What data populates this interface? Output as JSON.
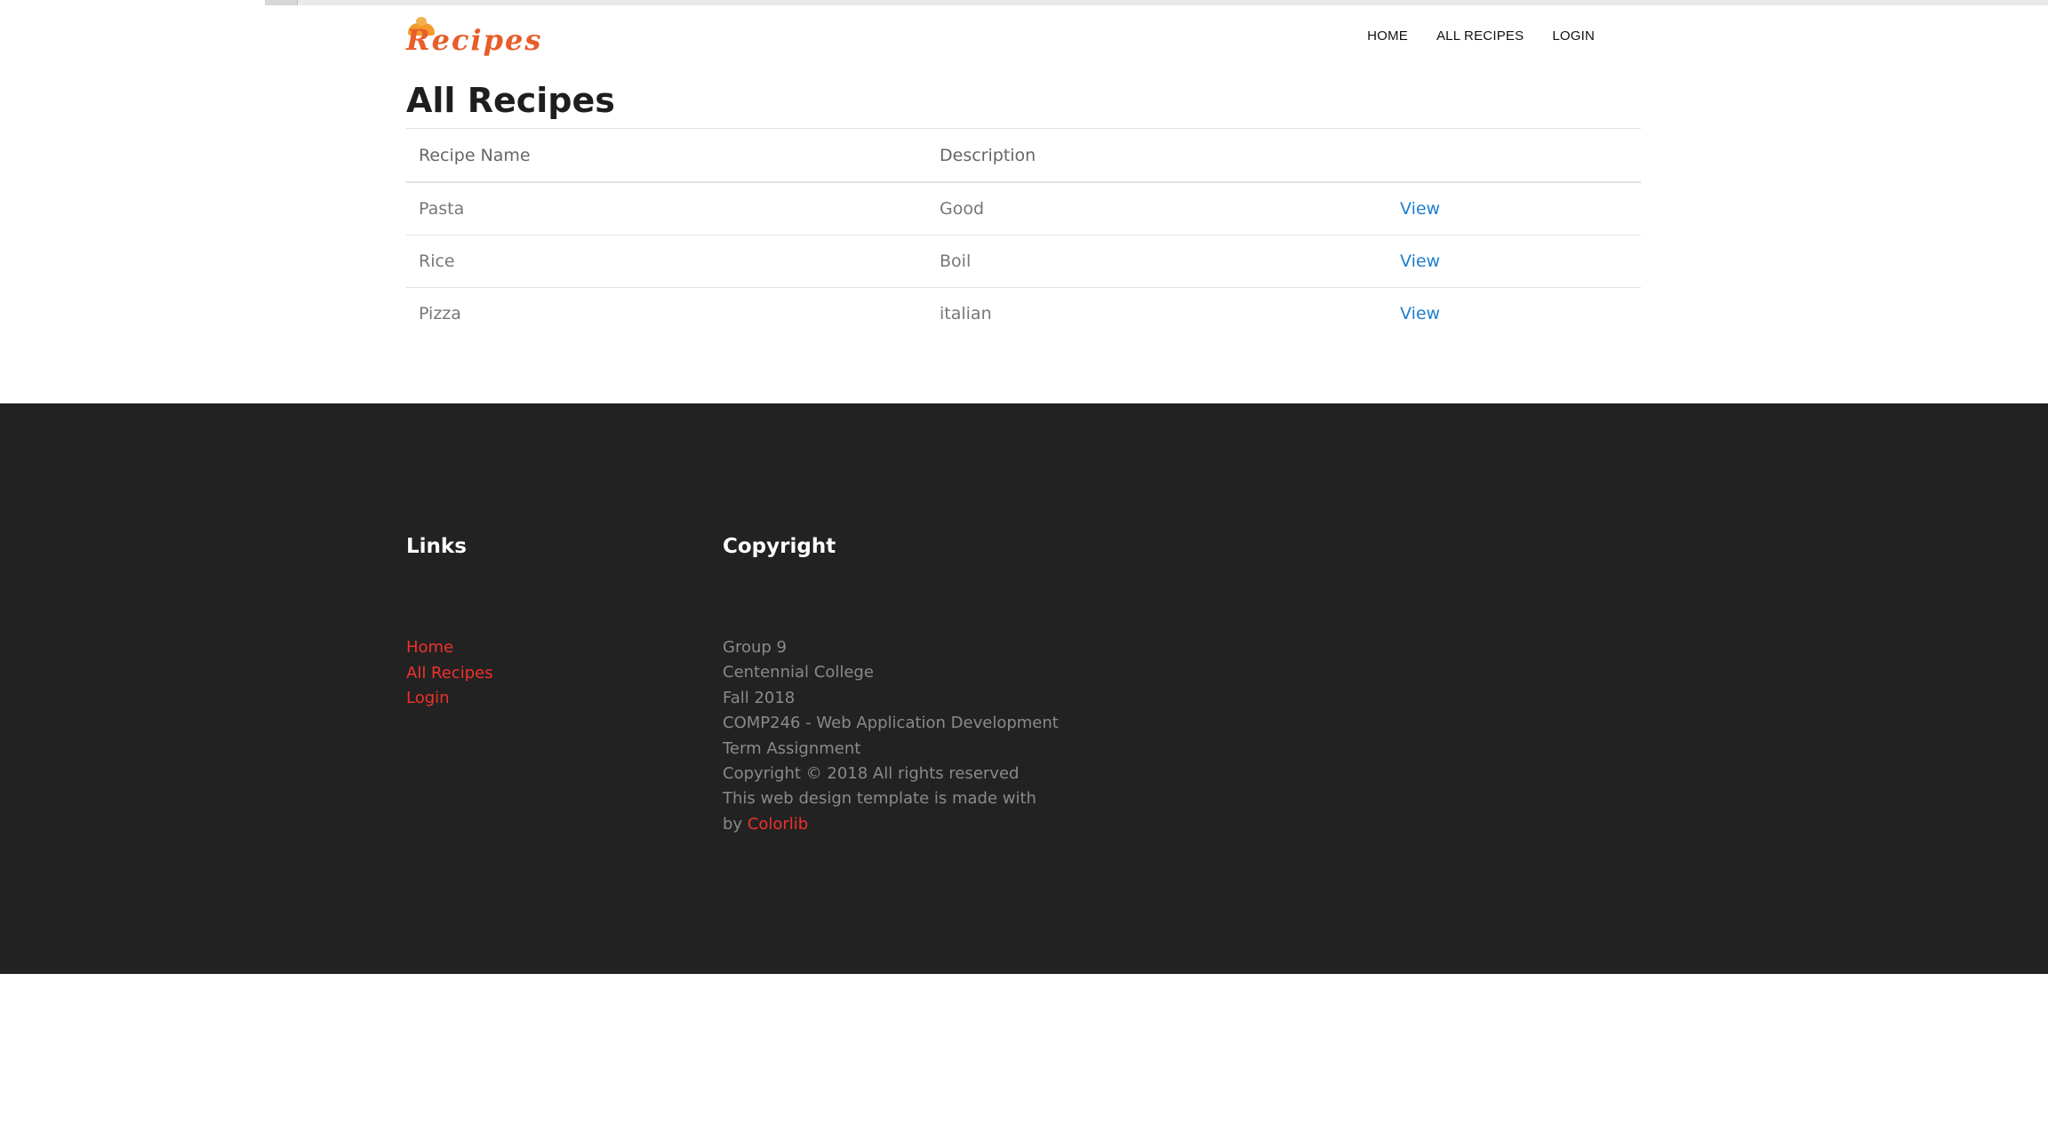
{
  "header": {
    "logo_text": "Recipes",
    "nav": [
      "HOME",
      "ALL RECIPES",
      "LOGIN"
    ]
  },
  "main": {
    "title": "All Recipes",
    "columns": [
      "Recipe Name",
      "Description",
      ""
    ],
    "rows": [
      {
        "name": "Pasta",
        "description": "Good",
        "action": "View"
      },
      {
        "name": "Rice",
        "description": "Boil",
        "action": "View"
      },
      {
        "name": "Pizza",
        "description": "italian",
        "action": "View"
      }
    ]
  },
  "footer": {
    "links_heading": "Links",
    "links": [
      "Home",
      "All Recipes",
      "Login"
    ],
    "copyright_heading": "Copyright",
    "copyright_lines": [
      "Group 9",
      "Centennial College",
      "Fall 2018",
      "COMP246 - Web Application Development",
      "Term Assignment",
      "Copyright © 2018 All rights reserved",
      "This web design template is made with"
    ],
    "credit_prefix": "by ",
    "credit_link": "Colorlib"
  },
  "colors": {
    "brand": "#e85d2a",
    "link_blue": "#1f7ecf",
    "footer_bg": "#222222",
    "footer_link": "#f0312c"
  }
}
